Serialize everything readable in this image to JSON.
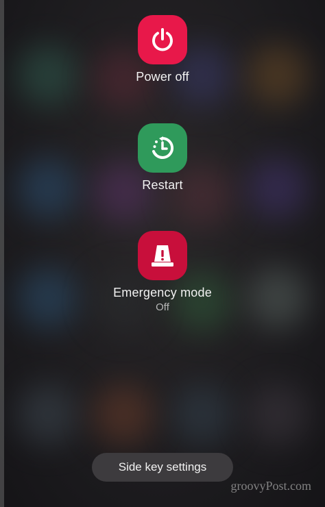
{
  "actions": [
    {
      "id": "power-off",
      "label": "Power off",
      "sub": "",
      "color": "#e8184a",
      "icon": "power-icon"
    },
    {
      "id": "restart",
      "label": "Restart",
      "sub": "",
      "color": "#2f9a5b",
      "icon": "restart-icon"
    },
    {
      "id": "emergency-mode",
      "label": "Emergency mode",
      "sub": "Off",
      "color": "#c80f3b",
      "icon": "emergency-light-icon"
    }
  ],
  "side_key_settings": {
    "label": "Side key settings"
  },
  "watermark": {
    "text": "groovyPost.com"
  }
}
